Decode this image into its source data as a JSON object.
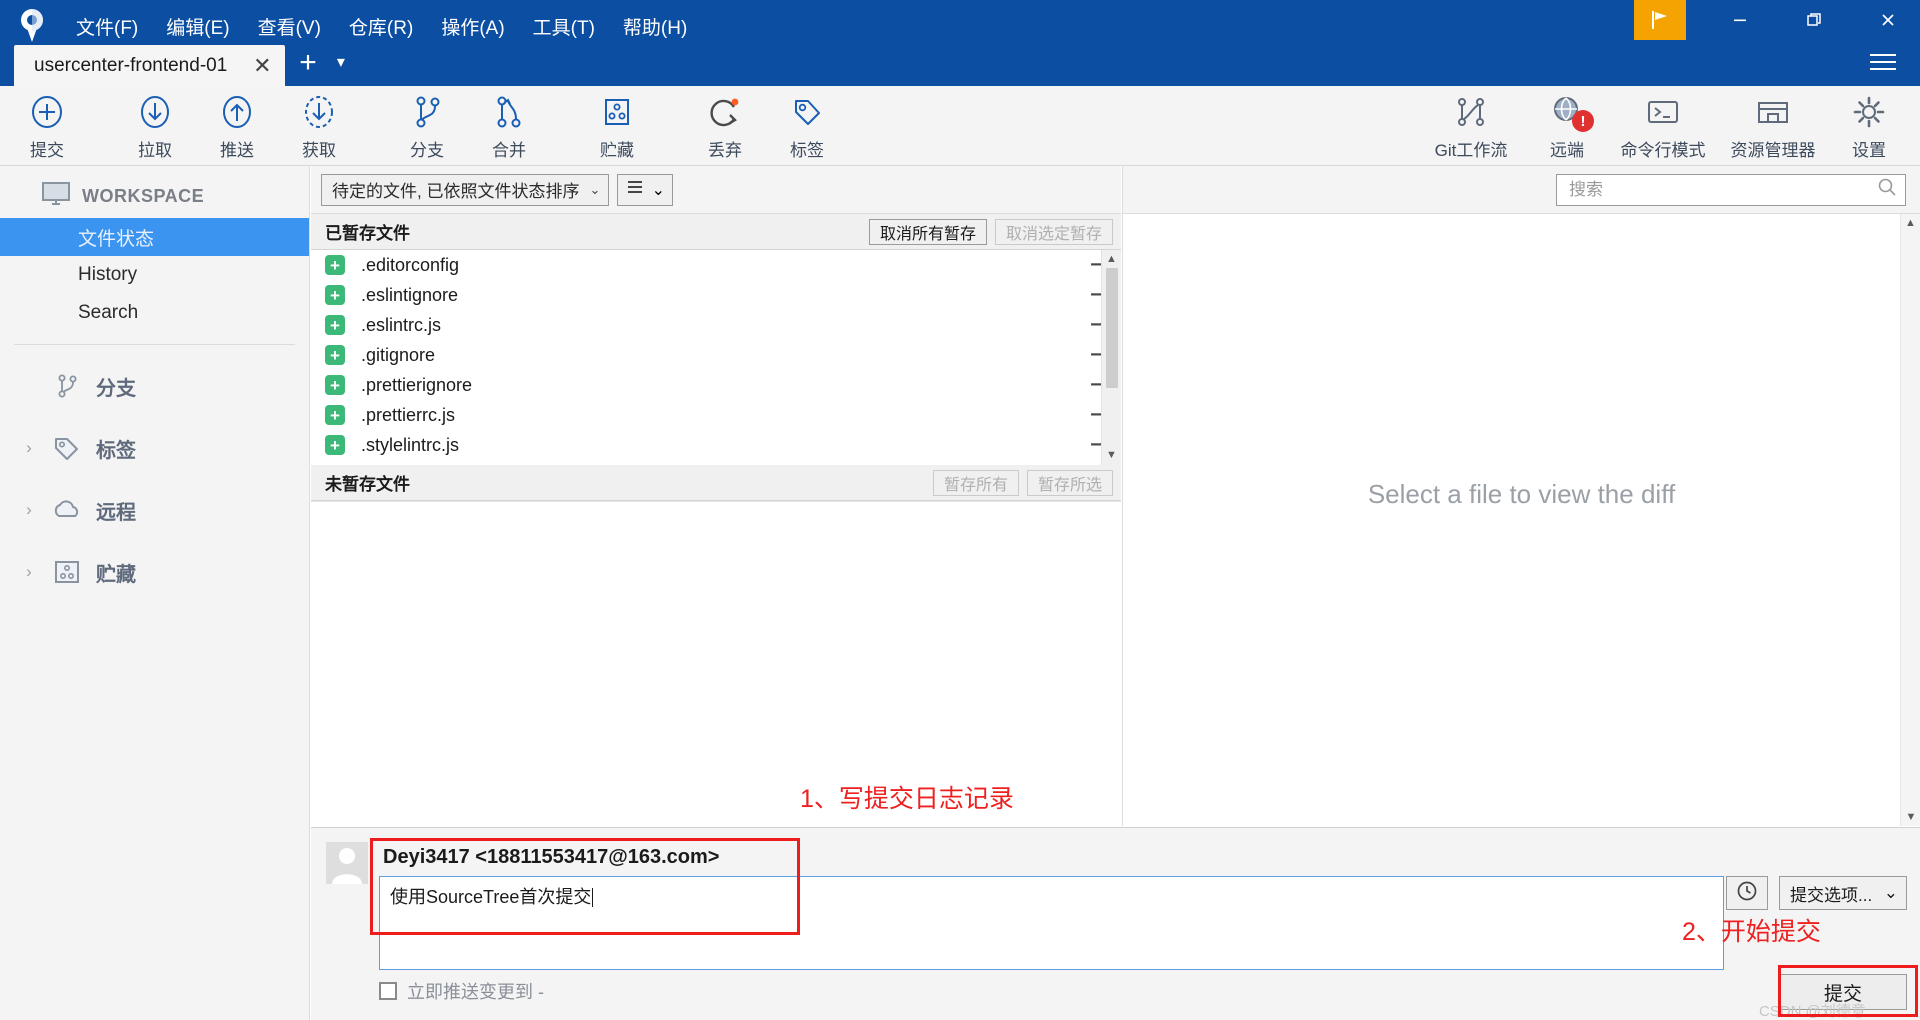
{
  "window": {
    "app_name": "SourceTree",
    "menu": [
      {
        "label": "文件(F)"
      },
      {
        "label": "编辑(E)"
      },
      {
        "label": "查看(V)"
      },
      {
        "label": "仓库(R)"
      },
      {
        "label": "操作(A)"
      },
      {
        "label": "工具(T)"
      },
      {
        "label": "帮助(H)"
      }
    ],
    "tab": {
      "label": "usercenter-frontend-01",
      "close": "✕"
    },
    "new_tab": "+",
    "tab_dropdown": "▾",
    "controls": {
      "minimize": "—",
      "maximize": "❐",
      "close": "✕"
    },
    "titlebar_color": "#0b4ea2",
    "flag_color": "#f5a300"
  },
  "toolbar": {
    "left": [
      {
        "label": "提交",
        "icon": "commit-plus-icon"
      },
      {
        "label": "拉取",
        "icon": "pull-down-arrow-icon"
      },
      {
        "label": "推送",
        "icon": "push-up-arrow-icon"
      },
      {
        "label": "获取",
        "icon": "fetch-dashed-arrow-icon"
      },
      {
        "label": "分支",
        "icon": "branch-icon"
      },
      {
        "label": "合并",
        "icon": "merge-icon"
      },
      {
        "label": "贮藏",
        "icon": "stash-icon"
      },
      {
        "label": "丢弃",
        "icon": "discard-refresh-icon"
      },
      {
        "label": "标签",
        "icon": "tag-icon"
      }
    ],
    "right": [
      {
        "label": "Git工作流",
        "icon": "gitflow-icon"
      },
      {
        "label": "远端",
        "icon": "remote-globe-icon",
        "badge": "!"
      },
      {
        "label": "命令行模式",
        "icon": "terminal-icon"
      },
      {
        "label": "资源管理器",
        "icon": "explorer-folder-icon"
      },
      {
        "label": "设置",
        "icon": "gear-icon"
      }
    ],
    "accent_color": "#1a5fb4"
  },
  "sidebar": {
    "workspace_label": "WORKSPACE",
    "items": [
      {
        "label": "文件状态",
        "active": true
      },
      {
        "label": "History",
        "active": false
      },
      {
        "label": "Search",
        "active": false
      }
    ],
    "groups": [
      {
        "label": "分支",
        "icon": "branch-icon",
        "chevron": ""
      },
      {
        "label": "标签",
        "icon": "tag-icon",
        "chevron": "›"
      },
      {
        "label": "远程",
        "icon": "cloud-icon",
        "chevron": "›"
      },
      {
        "label": "贮藏",
        "icon": "stash-icon",
        "chevron": "›"
      }
    ],
    "active_color": "#3b95f0"
  },
  "center": {
    "filter": {
      "sort_label": "待定的文件, 已依照文件状态排序",
      "caret": "⌄",
      "view_icon": "list-view-icon"
    },
    "staged": {
      "title": "已暂存文件",
      "unstage_all": "取消所有暂存",
      "unstage_selected": "取消选定暂存",
      "unstage_selected_disabled": true,
      "files": [
        {
          "name": ".editorconfig",
          "status": "+",
          "action": "−"
        },
        {
          "name": ".eslintignore",
          "status": "+",
          "action": "−"
        },
        {
          "name": ".eslintrc.js",
          "status": "+",
          "action": "−"
        },
        {
          "name": ".gitignore",
          "status": "+",
          "action": "−"
        },
        {
          "name": ".prettierignore",
          "status": "+",
          "action": "−"
        },
        {
          "name": ".prettierrc.js",
          "status": "+",
          "action": "−"
        },
        {
          "name": ".stylelintrc.js",
          "status": "+",
          "action": "−"
        }
      ],
      "status_color": "#3cb878"
    },
    "unstaged": {
      "title": "未暂存文件",
      "stage_all": "暂存所有",
      "stage_selected": "暂存所选",
      "files": []
    }
  },
  "diff": {
    "search_placeholder": "搜索",
    "search_value": "",
    "search_icon": "search-icon",
    "empty_message": "Select a file to view the diff"
  },
  "commit": {
    "author": "Deyi3417 <18811553417@163.com>",
    "message": "使用SourceTree首次提交",
    "history_icon": "clock-history-icon",
    "options_label": "提交选项...",
    "options_caret": "⌄",
    "push_checkbox_label": "立即推送变更到 -",
    "push_checked": false,
    "commit_button": "提交",
    "watermark": "CSDN @刘德意"
  },
  "annotations": {
    "note_1": "1、写提交日志记录",
    "note_2": "2、开始提交",
    "color": "#ee2020"
  }
}
